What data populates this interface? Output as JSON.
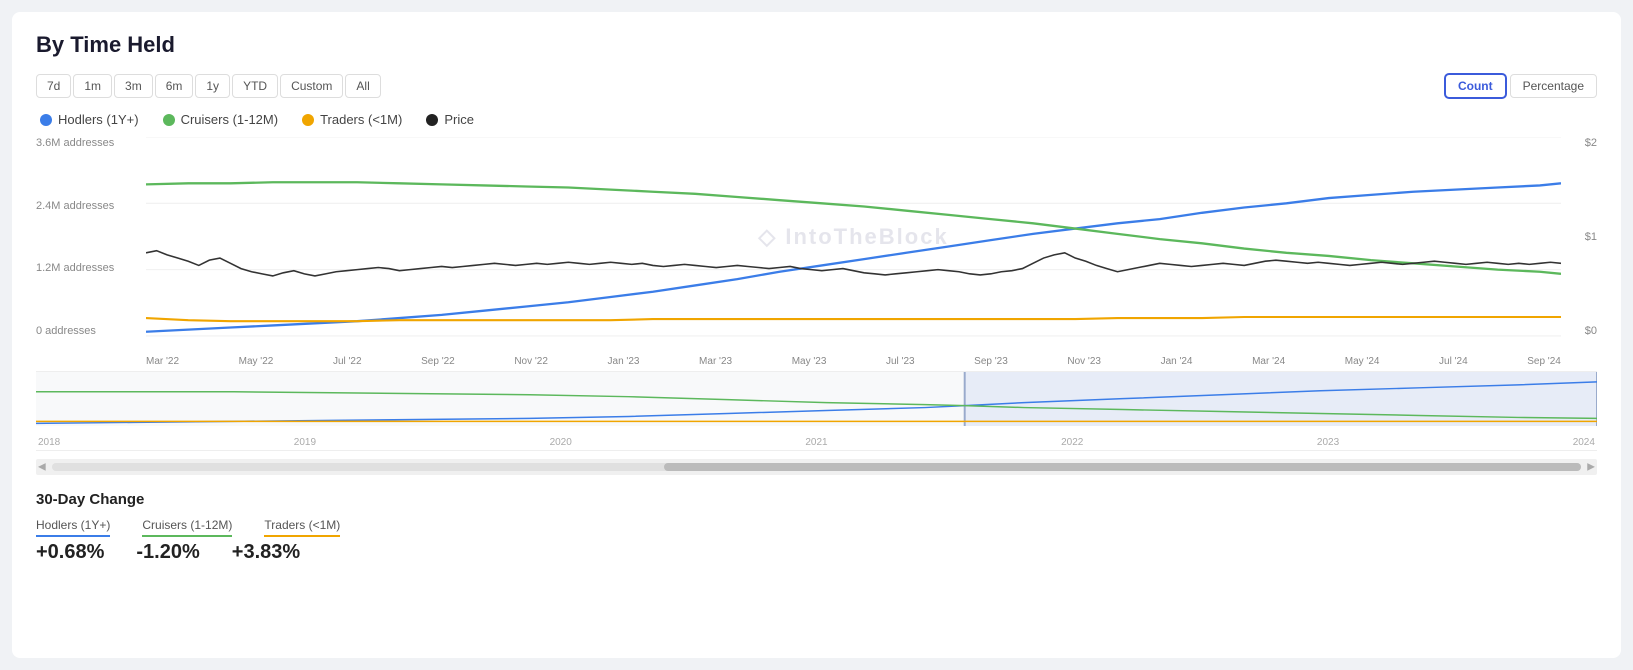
{
  "title": "By Time Held",
  "timeButtons": [
    {
      "label": "7d",
      "id": "7d",
      "active": false
    },
    {
      "label": "1m",
      "id": "1m",
      "active": false
    },
    {
      "label": "3m",
      "id": "3m",
      "active": false
    },
    {
      "label": "6m",
      "id": "6m",
      "active": false
    },
    {
      "label": "1y",
      "id": "1y",
      "active": false
    },
    {
      "label": "YTD",
      "id": "ytd",
      "active": false
    },
    {
      "label": "Custom",
      "id": "custom",
      "active": false
    },
    {
      "label": "All",
      "id": "all",
      "active": false
    }
  ],
  "viewToggle": {
    "count": "Count",
    "percentage": "Percentage",
    "active": "count"
  },
  "legend": [
    {
      "label": "Hodlers (1Y+)",
      "color": "#3b7de8",
      "type": "dot"
    },
    {
      "label": "Cruisers (1-12M)",
      "color": "#5cb85c",
      "type": "dot"
    },
    {
      "label": "Traders (<1M)",
      "color": "#f0a500",
      "type": "dot"
    },
    {
      "label": "Price",
      "color": "#222",
      "type": "dot"
    }
  ],
  "yAxisLeft": [
    "3.6M addresses",
    "2.4M addresses",
    "1.2M addresses",
    "0 addresses"
  ],
  "yAxisRight": [
    "$2",
    "$1",
    "$0"
  ],
  "xAxisLabels": [
    "Mar '22",
    "May '22",
    "Jul '22",
    "Sep '22",
    "Nov '22",
    "Jan '23",
    "Mar '23",
    "May '23",
    "Jul '23",
    "Sep '23",
    "Nov '23",
    "Jan '24",
    "Mar '24",
    "May '24",
    "Jul '24",
    "Sep '24"
  ],
  "miniXLabels": [
    "2018",
    "2019",
    "2020",
    "2021",
    "2022",
    "2023",
    "2024"
  ],
  "watermark": "◇ IntoTheBlock",
  "changes": {
    "title": "30-Day Change",
    "columns": [
      {
        "label": "Hodlers (1Y+)",
        "color": "blue",
        "value": "+0.68%"
      },
      {
        "label": "Cruisers (1-12M)",
        "color": "green",
        "value": "-1.20%"
      },
      {
        "label": "Traders (<1M)",
        "color": "orange",
        "value": "+3.83%"
      }
    ]
  }
}
